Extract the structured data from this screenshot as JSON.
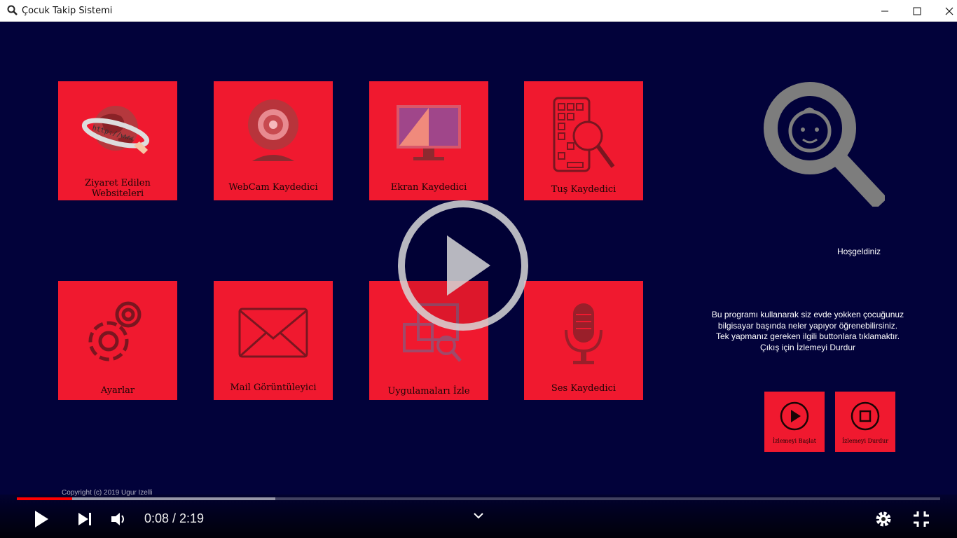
{
  "window": {
    "title": "Çocuk Takip Sistemi",
    "controls": {
      "minimize": "—",
      "maximize": "☐",
      "close": "✕"
    }
  },
  "tiles": [
    {
      "label": "Ziyaret Edilen Websiteleri",
      "icon": "globe-www-icon"
    },
    {
      "label": "WebCam Kaydedici",
      "icon": "webcam-icon"
    },
    {
      "label": "Ekran Kaydedici",
      "icon": "monitor-icon"
    },
    {
      "label": "Tuş Kaydedici",
      "icon": "keyboard-search-icon"
    },
    {
      "label": "Ayarlar",
      "icon": "gears-icon"
    },
    {
      "label": "Mail Görüntüleyici",
      "icon": "envelope-icon"
    },
    {
      "label": "Uygulamaları İzle",
      "icon": "app-monitor-search-icon"
    },
    {
      "label": "Ses  Kaydedici",
      "icon": "microphone-icon"
    }
  ],
  "panel": {
    "welcome": "Hoşgeldiniz",
    "info_lines": [
      "Bu programı kullanarak siz evde yokken çocuğunuz",
      "bilgisayar başında neler yapıyor öğrenebilirsiniz.",
      "Tek yapmanız gereken ilgili buttonlara tıklamaktır.",
      "Çıkış için İzlemeyi Durdur"
    ],
    "start_label": "İzlemeyi Başlat",
    "stop_label": "İzlemeyi Durdur"
  },
  "copyright": "Copyright (c) 2019 Ugur Izelli",
  "player": {
    "current_time": "0:08",
    "duration": "2:19",
    "time_display": "0:08 / 2:19",
    "played_fraction": 0.06,
    "buffered_fraction": 0.28
  },
  "colors": {
    "background": "#02023a",
    "tile": "#f0192f",
    "progress": "#ff0000"
  }
}
